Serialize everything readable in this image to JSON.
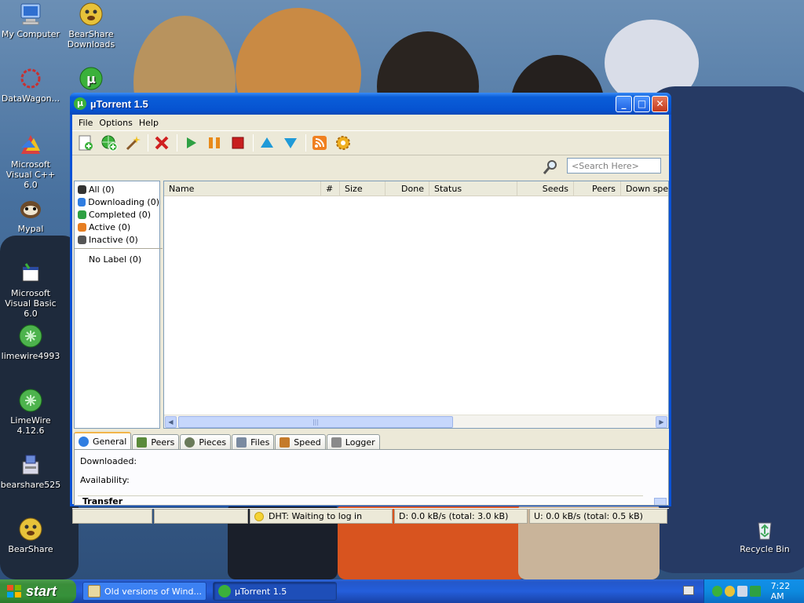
{
  "desktop": {
    "icons": [
      {
        "label": "My Computer",
        "color": "#9ec3f5"
      },
      {
        "label": "BearShare Downloads",
        "color": "#e7c23a"
      },
      {
        "label": "DataWagon...",
        "color": "#c83030"
      },
      {
        "label": "",
        "color": "#3bb13b"
      },
      {
        "label": "Microsoft Visual C++ 6.0",
        "color": "#d84040"
      },
      {
        "label": "Mypal",
        "color": "#6b4a2a"
      },
      {
        "label": "Microsoft Visual Basic 6.0",
        "color": "#8c8c8c"
      },
      {
        "label": "limewire4993",
        "color": "#4db34d"
      },
      {
        "label": "LimeWire 4.12.6",
        "color": "#4db34d"
      },
      {
        "label": "bearshare525",
        "color": "#6a8ad8"
      },
      {
        "label": "BearShare",
        "color": "#e7c23a"
      },
      {
        "label": "Recycle Bin",
        "color": "#3fa65a"
      }
    ]
  },
  "window": {
    "title": "µTorrent 1.5",
    "app_icon": "µ",
    "controls": {
      "minimize": "_",
      "maximize": "□",
      "close": "✕"
    },
    "menu": [
      "File",
      "Options",
      "Help"
    ],
    "search_placeholder": "<Search Here>",
    "sidebar": {
      "items": [
        {
          "label": "All (0)",
          "color": "#333333"
        },
        {
          "label": "Downloading (0)",
          "color": "#2f7de1"
        },
        {
          "label": "Completed (0)",
          "color": "#2ea043"
        },
        {
          "label": "Active (0)",
          "color": "#e67e22"
        },
        {
          "label": "Inactive (0)",
          "color": "#555555"
        }
      ],
      "no_label": "No Label (0)"
    },
    "columns": [
      "Name",
      "#",
      "Size",
      "Done",
      "Status",
      "Seeds",
      "Peers",
      "Down speed"
    ],
    "scroll": {
      "left": "◀",
      "right": "▶",
      "grip": "|||"
    },
    "tabs": [
      {
        "label": "General",
        "color": "#2f7de1"
      },
      {
        "label": "Peers",
        "color": "#5a8a3a"
      },
      {
        "label": "Pieces",
        "color": "#6a7a5a"
      },
      {
        "label": "Files",
        "color": "#7a8aa0"
      },
      {
        "label": "Speed",
        "color": "#c47a2a"
      },
      {
        "label": "Logger",
        "color": "#8a8a8a"
      }
    ],
    "details": {
      "downloaded_label": "Downloaded:",
      "availability_label": "Availability:",
      "transfer_label": "Transfer"
    },
    "status": {
      "dht": "DHT: Waiting to log in",
      "download": "D: 0.0 kB/s  (total: 3.0 kB)",
      "upload": "U: 0.0 kB/s  (total: 0.5 kB)"
    }
  },
  "taskbar": {
    "start_label": "start",
    "tasks": [
      {
        "label": "Old versions of Wind...",
        "active": false
      },
      {
        "label": "µTorrent 1.5",
        "active": true
      }
    ],
    "clock": "7:22 AM"
  }
}
